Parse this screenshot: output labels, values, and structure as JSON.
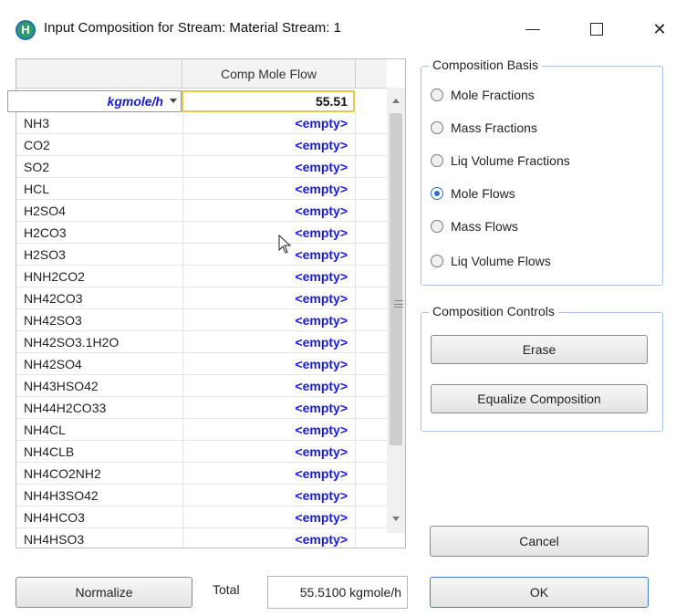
{
  "window": {
    "title": "Input Composition for Stream: Material Stream: 1",
    "icon_letter": "H",
    "controls": [
      "minimize-icon",
      "maximize-icon",
      "close-icon"
    ],
    "close_glyph": "✕"
  },
  "grid": {
    "column_header": "Comp Mole Flow",
    "units": "kgmole/h",
    "total_value": "55.51",
    "rows": [
      {
        "name": "NH3",
        "value": "<empty>"
      },
      {
        "name": "CO2",
        "value": "<empty>"
      },
      {
        "name": "SO2",
        "value": "<empty>"
      },
      {
        "name": "HCL",
        "value": "<empty>"
      },
      {
        "name": "H2SO4",
        "value": "<empty>"
      },
      {
        "name": "H2CO3",
        "value": "<empty>"
      },
      {
        "name": "H2SO3",
        "value": "<empty>"
      },
      {
        "name": "HNH2CO2",
        "value": "<empty>"
      },
      {
        "name": "NH42CO3",
        "value": "<empty>"
      },
      {
        "name": "NH42SO3",
        "value": "<empty>"
      },
      {
        "name": "NH42SO3.1H2O",
        "value": "<empty>"
      },
      {
        "name": "NH42SO4",
        "value": "<empty>"
      },
      {
        "name": "NH43HSO42",
        "value": "<empty>"
      },
      {
        "name": "NH44H2CO33",
        "value": "<empty>"
      },
      {
        "name": "NH4CL",
        "value": "<empty>"
      },
      {
        "name": "NH4CLB",
        "value": "<empty>"
      },
      {
        "name": "NH4CO2NH2",
        "value": "<empty>"
      },
      {
        "name": "NH4H3SO42",
        "value": "<empty>"
      },
      {
        "name": "NH4HCO3",
        "value": "<empty>"
      },
      {
        "name": "NH4HSO3",
        "value": "<empty>"
      }
    ]
  },
  "composition_basis": {
    "legend": "Composition Basis",
    "options": [
      {
        "label": "Mole Fractions",
        "selected": false
      },
      {
        "label": "Mass Fractions",
        "selected": false
      },
      {
        "label": "Liq Volume Fractions",
        "selected": false
      },
      {
        "label": "Mole Flows",
        "selected": true
      },
      {
        "label": "Mass Flows",
        "selected": false
      },
      {
        "label": "Liq Volume Flows",
        "selected": false
      }
    ]
  },
  "composition_controls": {
    "legend": "Composition Controls",
    "erase_label": "Erase",
    "equalize_label": "Equalize Composition"
  },
  "footer": {
    "normalize_label": "Normalize",
    "total_label": "Total",
    "total_value": "55.5100 kgmole/h",
    "cancel_label": "Cancel",
    "ok_label": "OK"
  },
  "colors": {
    "empty_text": "#1a1adb",
    "selected_radio": "#2b6fd6",
    "group_border": "#a9c3e6",
    "total_cell_border": "#e8c84a"
  }
}
